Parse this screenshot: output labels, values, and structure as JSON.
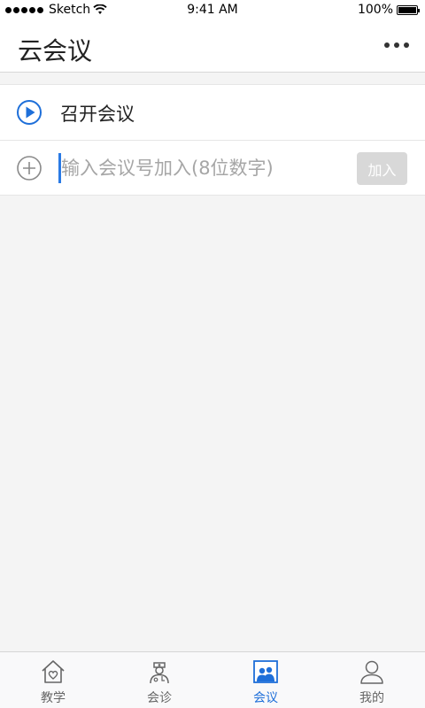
{
  "status_bar": {
    "carrier": "Sketch",
    "time": "9:41 AM",
    "battery": "100%"
  },
  "header": {
    "title": "云会议",
    "more_icon": "more-horizontal-icon"
  },
  "actions": {
    "start_meeting": {
      "label": "召开会议",
      "icon": "play-circle-icon",
      "accent": "#1e6fd9"
    },
    "join_meeting": {
      "icon": "plus-circle-icon",
      "placeholder": "输入会议号加入(8位数字)",
      "value": "",
      "button_label": "加入"
    }
  },
  "tabs": [
    {
      "label": "教学",
      "icon": "house-heart-icon",
      "active": false
    },
    {
      "label": "会诊",
      "icon": "doctor-icon",
      "active": false
    },
    {
      "label": "会议",
      "icon": "meeting-icon",
      "active": true
    },
    {
      "label": "我的",
      "icon": "person-icon",
      "active": false
    }
  ],
  "colors": {
    "accent": "#1e6fd9",
    "background": "#f4f4f4",
    "disabled_button": "#d8d8d8"
  }
}
